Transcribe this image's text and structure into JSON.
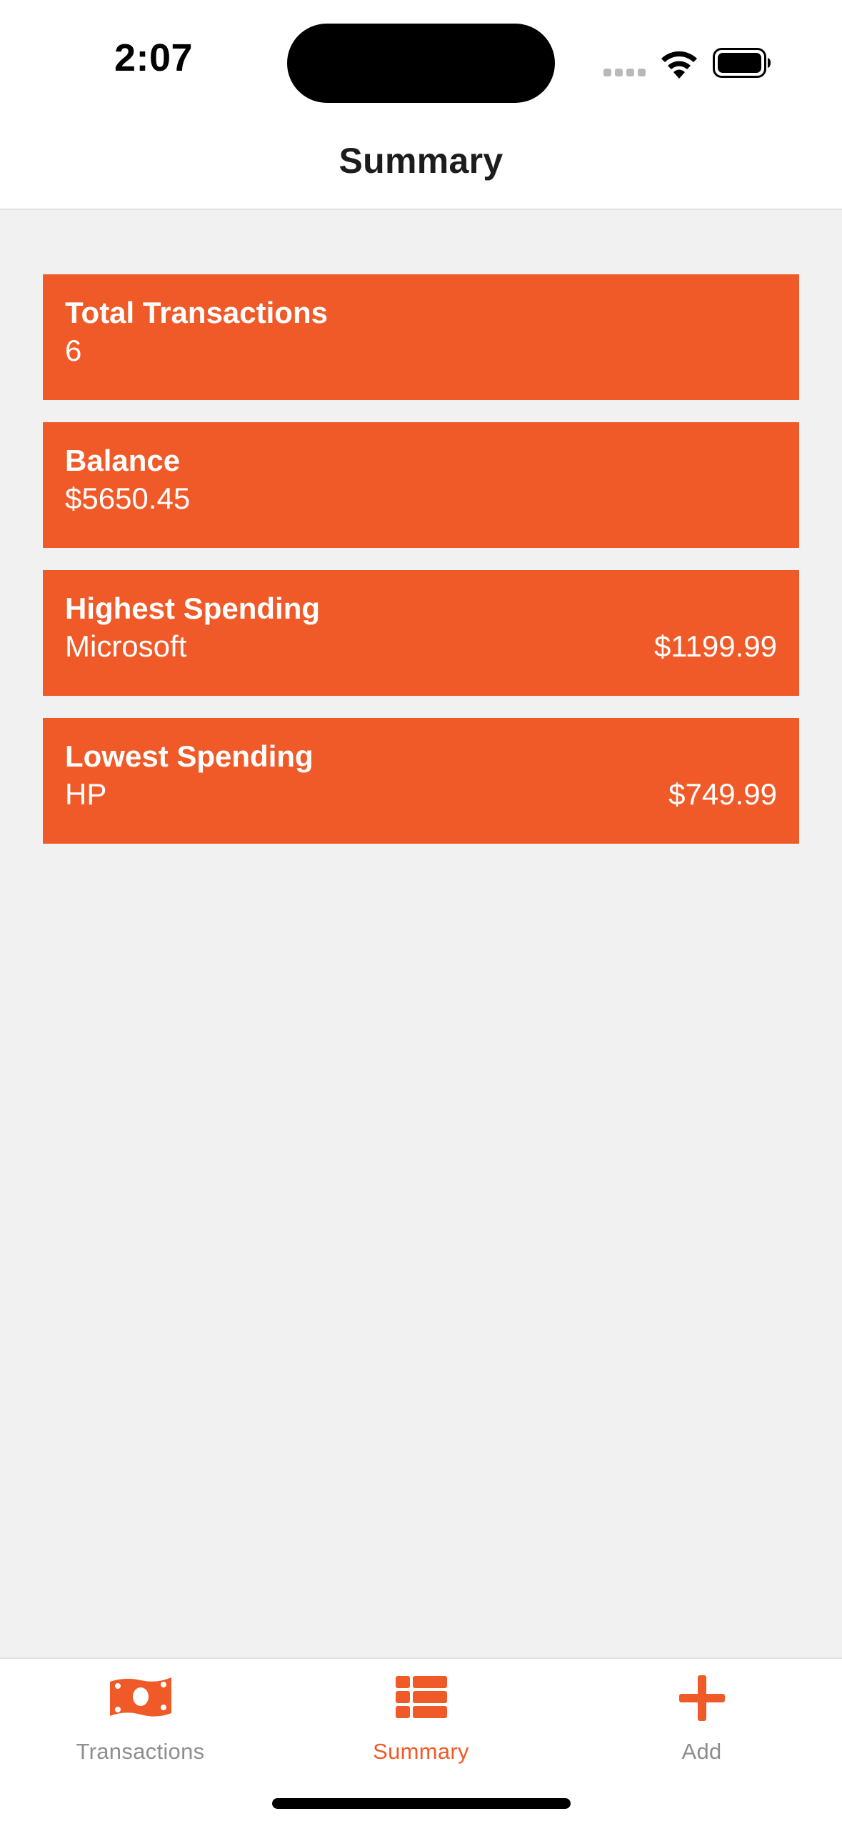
{
  "status_bar": {
    "time": "2:07"
  },
  "nav": {
    "title": "Summary"
  },
  "cards": [
    {
      "title": "Total Transactions",
      "value": "6",
      "amount": ""
    },
    {
      "title": "Balance",
      "value": "$5650.45",
      "amount": ""
    },
    {
      "title": "Highest Spending",
      "value": "Microsoft",
      "amount": "$1199.99"
    },
    {
      "title": "Lowest Spending",
      "value": "HP",
      "amount": "$749.99"
    }
  ],
  "tabbar": {
    "items": [
      {
        "label": "Transactions",
        "icon": "banknote-icon",
        "active": false
      },
      {
        "label": "Summary",
        "icon": "list-icon",
        "active": true
      },
      {
        "label": "Add",
        "icon": "plus-icon",
        "active": false
      }
    ]
  },
  "colors": {
    "accent": "#f05a28",
    "background": "#f1f1f1",
    "inactive_tab": "#8e8e8e"
  }
}
